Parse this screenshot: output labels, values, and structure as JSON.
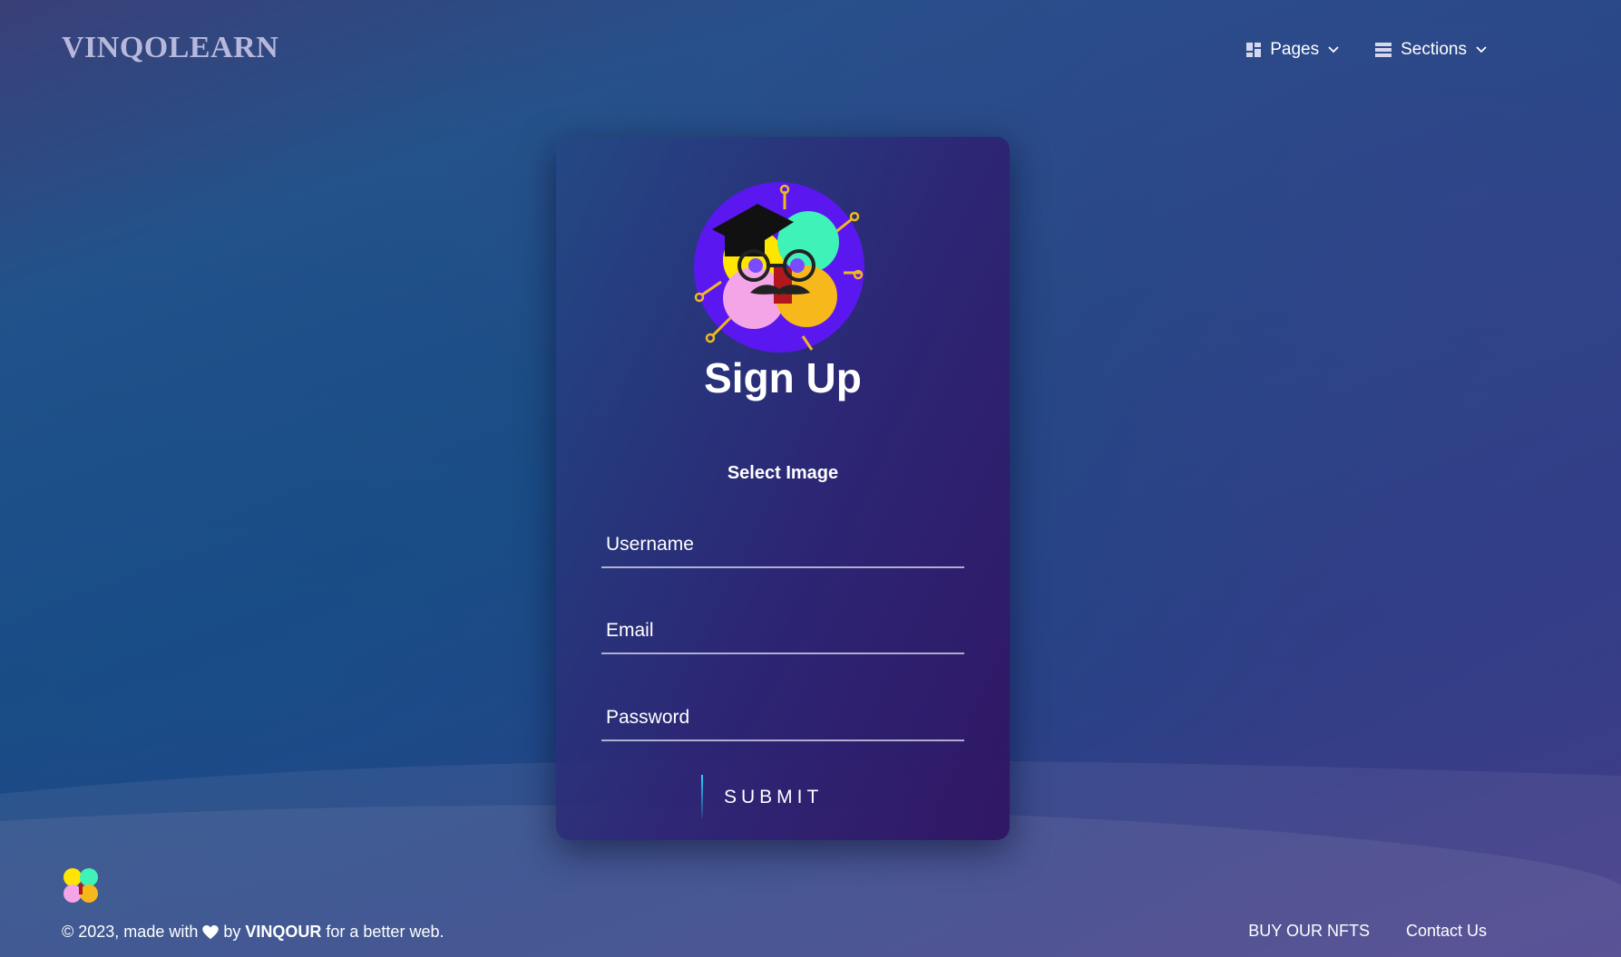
{
  "header": {
    "brand": "VINQOLEARN",
    "nav": [
      {
        "label": "Pages",
        "icon": "dashboard-icon"
      },
      {
        "label": "Sections",
        "icon": "layers-icon"
      }
    ]
  },
  "card": {
    "title": "Sign Up",
    "select_image_label": "Select Image",
    "fields": {
      "username": {
        "placeholder": "Username",
        "value": ""
      },
      "email": {
        "placeholder": "Email",
        "value": ""
      },
      "password": {
        "placeholder": "Password",
        "value": ""
      }
    },
    "submit_label": "SUBMIT"
  },
  "footer": {
    "copyright_prefix": "© 2023, made with",
    "by": "by",
    "company": "VINQOUR",
    "suffix": "for a better web.",
    "links": [
      "BUY OUR NFTS",
      "Contact Us"
    ]
  },
  "colors": {
    "accent": "#2fd0ff",
    "avatar_bg": "#5a17f0"
  }
}
